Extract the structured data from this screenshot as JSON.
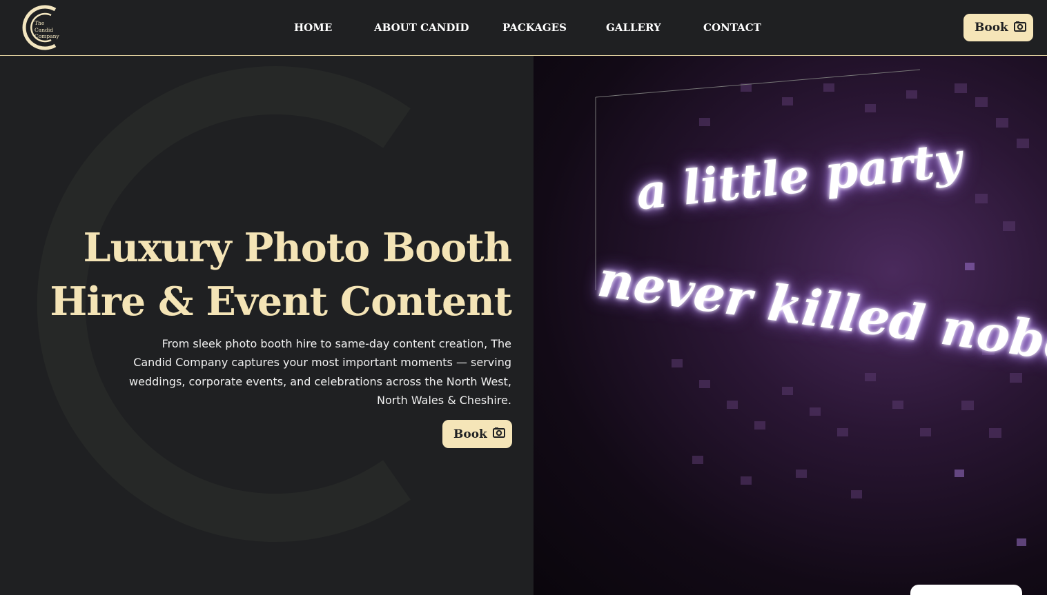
{
  "header": {
    "logo": {
      "line1": "The",
      "line2": "Candid",
      "line3": "Company"
    },
    "nav": [
      "HOME",
      "ABOUT CANDID",
      "PACKAGES",
      "GALLERY",
      "CONTACT"
    ],
    "book_label": "Book"
  },
  "hero": {
    "title_line1": "Luxury Photo Booth",
    "title_line2": "Hire & Event Content",
    "description": "From sleek photo booth hire to same-day content creation, The Candid Company captures your most important moments — serving weddings, corporate events, and celebrations across the North West, North Wales & Cheshire.",
    "book_label": "Book"
  },
  "hero_image": {
    "neon_line1": "a little party",
    "neon_line2": "never killed nobody"
  },
  "colors": {
    "background": "#1f2022",
    "accent_cream": "#f5e5b8",
    "title_cream": "#f4e4b6"
  },
  "icons": {
    "book": "camera-icon",
    "logo": "candid-c-logo"
  }
}
